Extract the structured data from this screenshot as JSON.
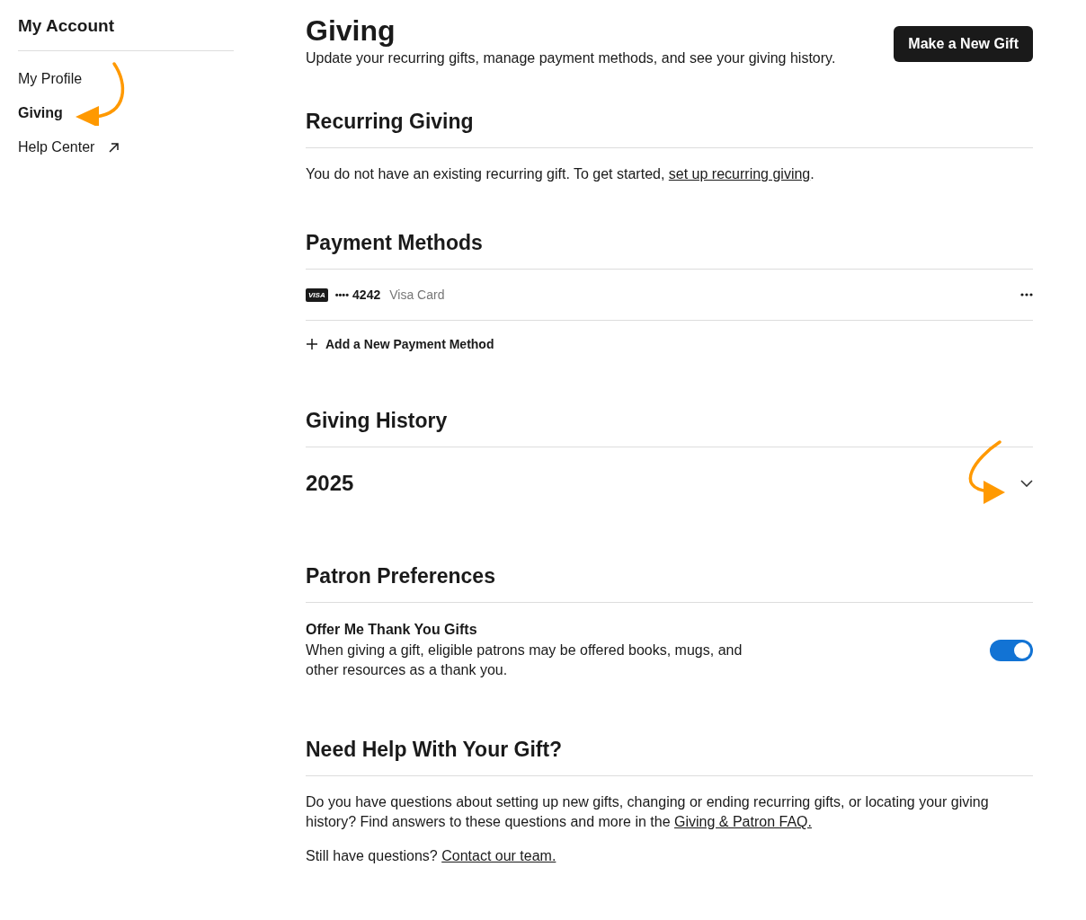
{
  "sidebar": {
    "title": "My Account",
    "items": [
      {
        "label": "My Profile",
        "selected": false,
        "external": false
      },
      {
        "label": "Giving",
        "selected": true,
        "external": false
      },
      {
        "label": "Help Center",
        "selected": false,
        "external": true
      }
    ]
  },
  "header": {
    "title": "Giving",
    "subtitle": "Update your recurring gifts, manage payment methods, and see your giving history.",
    "button": "Make a New Gift"
  },
  "recurring": {
    "heading": "Recurring Giving",
    "text": "You do not have an existing recurring gift. To get started, ",
    "link": "set up recurring giving",
    "after": "."
  },
  "payment": {
    "heading": "Payment Methods",
    "cards": [
      {
        "brand": "VISA",
        "dots": "••••",
        "last4": "4242",
        "label": "Visa Card"
      }
    ],
    "add": "Add a New Payment Method"
  },
  "history": {
    "heading": "Giving History",
    "years": [
      {
        "label": "2025",
        "expanded": false
      }
    ]
  },
  "preferences": {
    "heading": "Patron Preferences",
    "items": [
      {
        "title": "Offer Me Thank You Gifts",
        "description": "When giving a gift, eligible patrons may be offered books, mugs, and other resources as a thank you.",
        "on": true
      }
    ]
  },
  "help": {
    "heading": "Need Help With Your Gift?",
    "text": "Do you have questions about setting up new gifts, changing or ending recurring gifts, or locating your giving history? Find answers to these questions and more in the ",
    "link": "Giving & Patron FAQ.",
    "text2": "Still have questions? ",
    "link2": "Contact our team."
  }
}
